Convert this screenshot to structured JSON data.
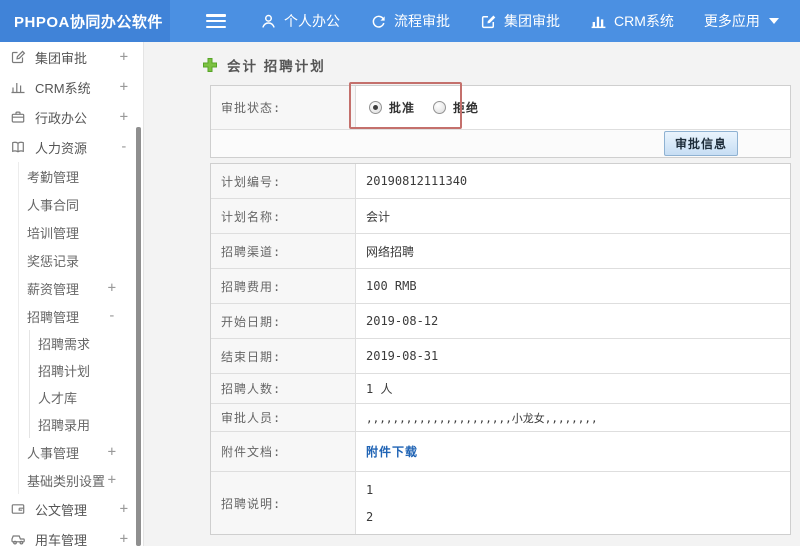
{
  "header": {
    "logo": "PHPOA协同办公软件",
    "nav": [
      {
        "label": "个人办公",
        "icon": "user-icon"
      },
      {
        "label": "流程审批",
        "icon": "cycle-icon"
      },
      {
        "label": "集团审批",
        "icon": "edit-icon"
      },
      {
        "label": "CRM系统",
        "icon": "bar-chart-icon"
      },
      {
        "label": "更多应用",
        "icon": "caret-down-icon"
      }
    ]
  },
  "sidebar": {
    "items": [
      {
        "label": "集团审批",
        "expander": "+"
      },
      {
        "label": "CRM系统",
        "expander": "+"
      },
      {
        "label": "行政办公",
        "expander": "+"
      },
      {
        "label": "人力资源",
        "expander": "-"
      },
      {
        "label": "考勤管理",
        "expander": ""
      },
      {
        "label": "人事合同",
        "expander": ""
      },
      {
        "label": "培训管理",
        "expander": ""
      },
      {
        "label": "奖惩记录",
        "expander": ""
      },
      {
        "label": "薪资管理",
        "expander": "+"
      },
      {
        "label": "招聘管理",
        "expander": "-"
      },
      {
        "label": "招聘需求",
        "expander": ""
      },
      {
        "label": "招聘计划",
        "expander": ""
      },
      {
        "label": "人才库",
        "expander": ""
      },
      {
        "label": "招聘录用",
        "expander": ""
      },
      {
        "label": "人事管理",
        "expander": "+"
      },
      {
        "label": "基础类别设置",
        "expander": "+"
      },
      {
        "label": "公文管理",
        "expander": "+"
      },
      {
        "label": "用车管理",
        "expander": "+"
      }
    ]
  },
  "main": {
    "title": "会计 招聘计划",
    "approval": {
      "label": "审批状态:",
      "options": [
        {
          "label": "批准",
          "selected": true
        },
        {
          "label": "拒绝",
          "selected": false
        }
      ],
      "button": "审批信息"
    },
    "fields": [
      {
        "label": "计划编号:",
        "value": "20190812111340"
      },
      {
        "label": "计划名称:",
        "value": "会计"
      },
      {
        "label": "招聘渠道:",
        "value": "网络招聘"
      },
      {
        "label": "招聘费用:",
        "value": "100 RMB"
      },
      {
        "label": "开始日期:",
        "value": "2019-08-12"
      },
      {
        "label": "结束日期:",
        "value": "2019-08-31"
      },
      {
        "label": "招聘人数:",
        "value": "1 人"
      },
      {
        "label": "审批人员:",
        "value": ",,,,,,,,,,,,,,,,,,,,,,小龙女,,,,,,,,"
      },
      {
        "label": "附件文档:",
        "value": "附件下载"
      },
      {
        "label": "招聘说明:",
        "lines": [
          "1",
          "2"
        ]
      }
    ]
  },
  "colors": {
    "header_blue": "#4b90e2",
    "logo_blue": "#4083d8",
    "highlight_red": "#c4706c",
    "link_blue": "#2064b5",
    "plus_green": "#7cc142",
    "button_blue": "#c7def4"
  }
}
